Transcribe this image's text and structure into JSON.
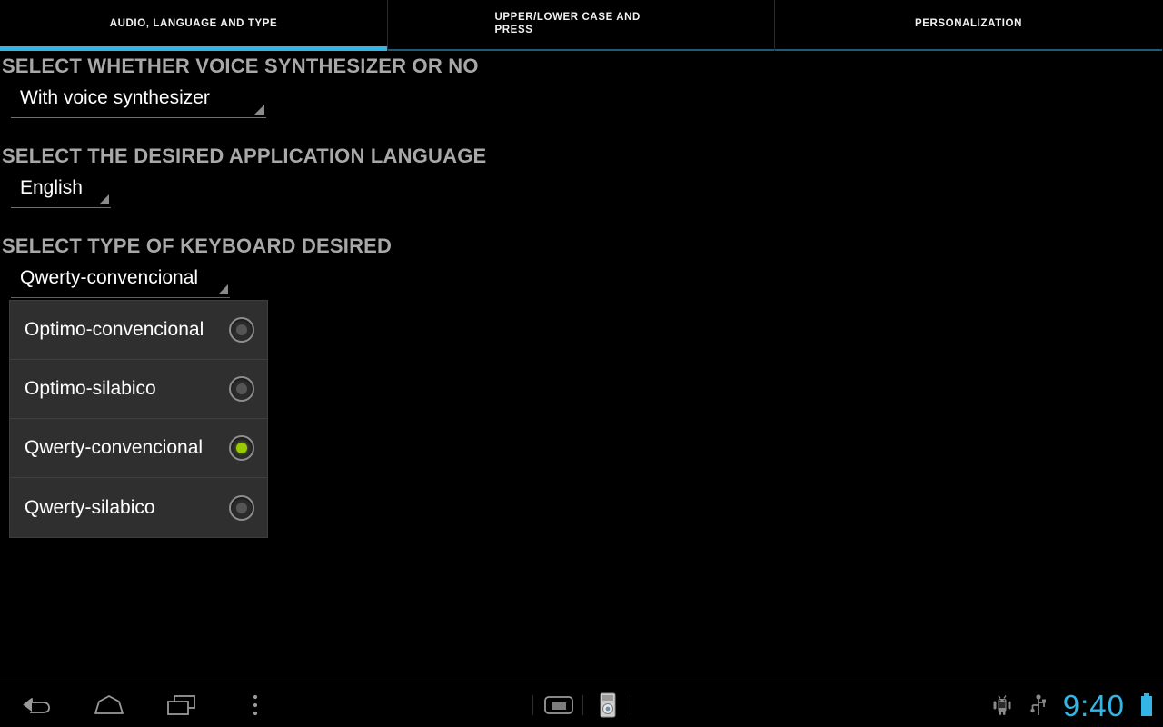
{
  "tabs": [
    {
      "label": "AUDIO, LANGUAGE AND TYPE",
      "active": true
    },
    {
      "label": "UPPER/LOWER CASE AND PRESS",
      "active": false
    },
    {
      "label": "PERSONALIZATION",
      "active": false
    }
  ],
  "sections": {
    "voice": {
      "header": "SELECT WHETHER VOICE SYNTHESIZER OR NO",
      "selected_value": "With voice synthesizer"
    },
    "language": {
      "header": "SELECT THE DESIRED APPLICATION LANGUAGE",
      "selected_value": "English"
    },
    "keyboard": {
      "header": "SELECT TYPE OF KEYBOARD DESIRED",
      "selected_value": "Qwerty-convencional",
      "options": [
        {
          "label": "Optimo-convencional",
          "selected": false
        },
        {
          "label": "Optimo-silabico",
          "selected": false
        },
        {
          "label": "Qwerty-convencional",
          "selected": true
        },
        {
          "label": "Qwerty-silabico",
          "selected": false
        }
      ]
    }
  },
  "nav_bar": {
    "back_icon": "back-arrow-icon",
    "home_icon": "home-icon",
    "recents_icon": "recent-apps-icon",
    "menu_icon": "overflow-menu-icon",
    "ime_icon": "keyboard-switcher-icon",
    "screenshot_icon": "screenshot-icon"
  },
  "status": {
    "adb_icon": "android-debug-icon",
    "usb_icon": "usb-icon",
    "clock": "9:40",
    "battery_icon": "battery-icon"
  },
  "colors": {
    "accent_blue": "#33b5e5",
    "inactive_underline": "#1d5c75",
    "selected_radio_green": "#99cc00",
    "header_gray": "#a8a8a8",
    "dropdown_bg": "#2f2f2f",
    "background": "#000000"
  }
}
